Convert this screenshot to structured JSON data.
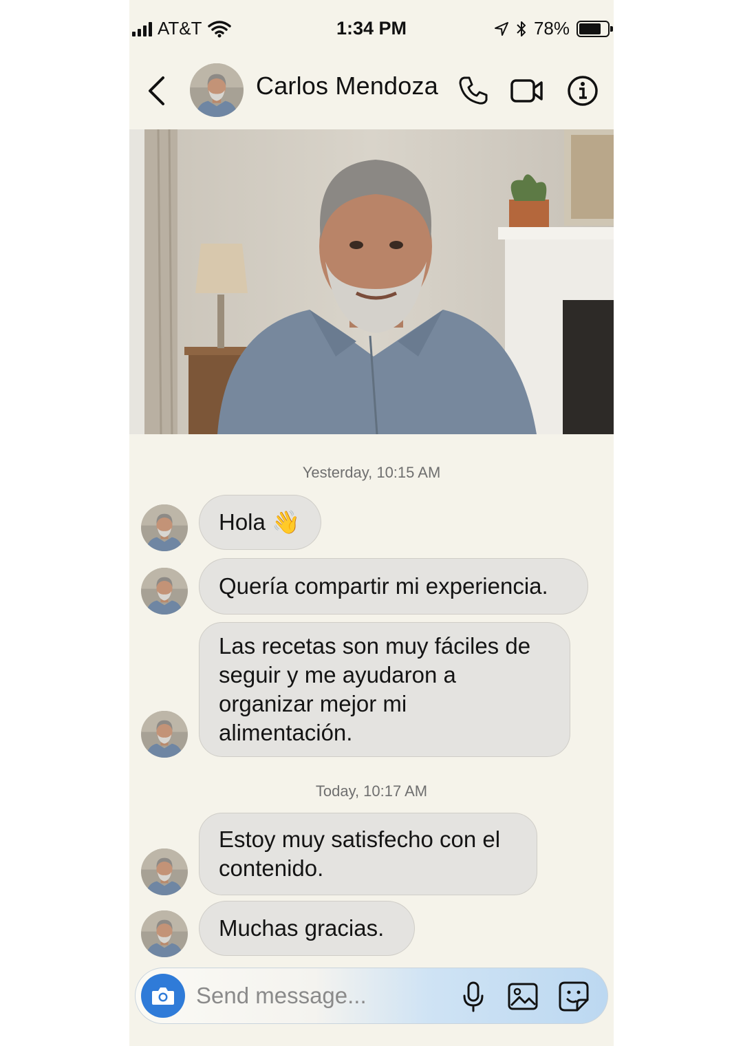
{
  "status_bar": {
    "carrier": "AT&T",
    "time": "1:34 PM",
    "battery": "78%",
    "battery_level": 0.78,
    "icons": [
      "signal-icon",
      "wifi-icon",
      "location-arrow-icon",
      "bluetooth-icon",
      "battery-icon"
    ]
  },
  "header": {
    "contact_name": "Carlos Mendoza",
    "icons": [
      "back-chevron-icon",
      "phone-icon",
      "video-camera-icon",
      "info-icon"
    ]
  },
  "chat": {
    "timestamps": [
      "Yesterday, 10:15 AM",
      "Today, 10:17 AM"
    ],
    "messages": [
      {
        "text": "Hola 👋"
      },
      {
        "text": "Quería compartir mi experiencia."
      },
      {
        "text": "Las recetas son muy fáciles de\nseguir y me ayudaron a\norganizar mejor mi\nalimentación."
      },
      {
        "text": "Estoy muy satisfecho con el\ncontenido."
      },
      {
        "text": "Muchas gracias."
      }
    ]
  },
  "composer": {
    "placeholder": "Send message...",
    "icons": [
      "camera-icon",
      "microphone-icon",
      "gallery-icon",
      "sticker-icon"
    ]
  },
  "colors": {
    "background": "#f5f3ea",
    "bubble": "#e4e3e0",
    "camera_button": "#2f7bd8",
    "timestamp_text": "#6f6f6f"
  }
}
